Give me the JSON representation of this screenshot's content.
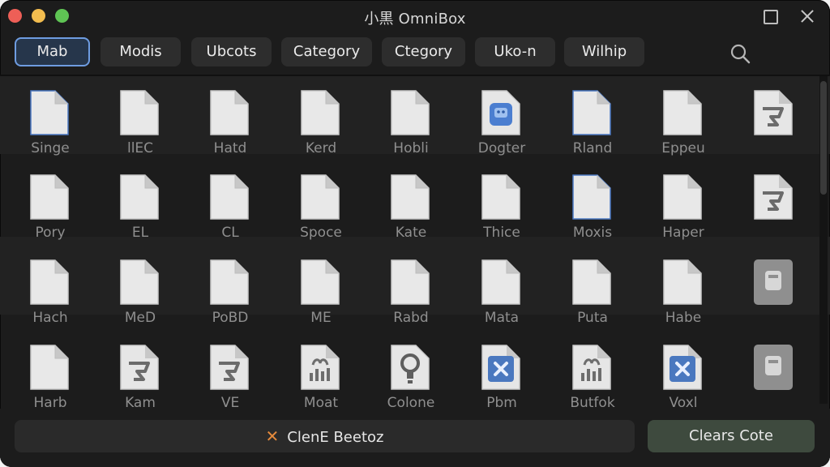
{
  "window": {
    "title": "小黒 OmniBox"
  },
  "tabs": [
    {
      "label": "Mab",
      "active": true
    },
    {
      "label": "Modis"
    },
    {
      "label": "Ubcots"
    },
    {
      "label": "Category"
    },
    {
      "label": "Ctegory"
    },
    {
      "label": "Uko-n"
    },
    {
      "label": "Wilhip"
    }
  ],
  "files": [
    {
      "label": "Singe",
      "icon": "document-icon"
    },
    {
      "label": "llEC",
      "icon": "document-icon"
    },
    {
      "label": "Hatd",
      "icon": "document-icon"
    },
    {
      "label": "Kerd",
      "icon": "document-icon"
    },
    {
      "label": "Hobli",
      "icon": "document-icon"
    },
    {
      "label": "Dogter",
      "icon": "robot-icon"
    },
    {
      "label": "Rland",
      "icon": "document-icon"
    },
    {
      "label": "Eppeu",
      "icon": "document-icon"
    },
    {
      "label": "",
      "icon": "image-icon"
    },
    {
      "label": "Pory",
      "icon": "document-icon"
    },
    {
      "label": "EL",
      "icon": "document-icon"
    },
    {
      "label": "CL",
      "icon": "document-icon"
    },
    {
      "label": "Spoce",
      "icon": "document-icon"
    },
    {
      "label": "Kate",
      "icon": "document-icon"
    },
    {
      "label": "Thice",
      "icon": "document-icon"
    },
    {
      "label": "Moxis",
      "icon": "document-icon"
    },
    {
      "label": "Haper",
      "icon": "document-icon"
    },
    {
      "label": "",
      "icon": "image-icon"
    },
    {
      "label": "Hach",
      "icon": "document-icon"
    },
    {
      "label": "MeD",
      "icon": "document-icon"
    },
    {
      "label": "PoBD",
      "icon": "document-icon"
    },
    {
      "label": "ME",
      "icon": "document-icon"
    },
    {
      "label": "Rabd",
      "icon": "document-icon"
    },
    {
      "label": "Mata",
      "icon": "document-icon"
    },
    {
      "label": "Puta",
      "icon": "document-icon"
    },
    {
      "label": "Habe",
      "icon": "document-icon"
    },
    {
      "label": "",
      "icon": "card-icon"
    },
    {
      "label": "Harb",
      "icon": "document-icon"
    },
    {
      "label": "Kam",
      "icon": "image-icon"
    },
    {
      "label": "VE",
      "icon": "image-icon"
    },
    {
      "label": "Moat",
      "icon": "chart-icon"
    },
    {
      "label": "Colone",
      "icon": "bulb-icon"
    },
    {
      "label": "Pbm",
      "icon": "x-icon"
    },
    {
      "label": "Butfok",
      "icon": "chart-icon"
    },
    {
      "label": "Voxl",
      "icon": "x-icon"
    },
    {
      "label": "",
      "icon": "card-icon"
    }
  ],
  "footer": {
    "clear_label": "ClenE Beetoz",
    "primary_label": "Clears Cote"
  }
}
